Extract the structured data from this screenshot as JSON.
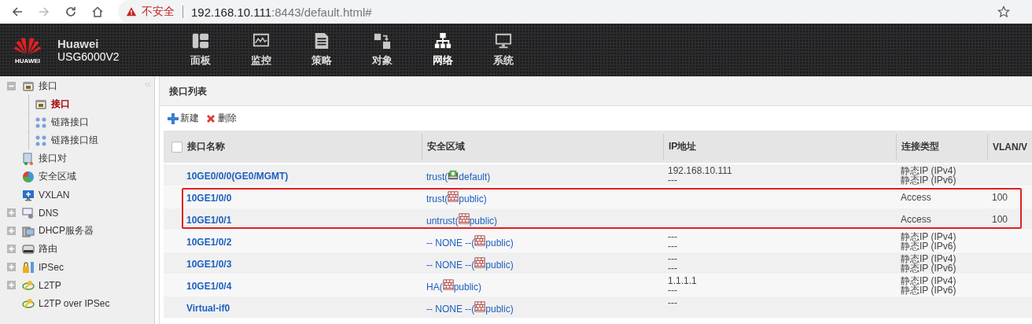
{
  "browser": {
    "forward_enabled": false,
    "security_label": "不安全",
    "url_host": "192.168.10.111",
    "url_rest": ":8443/default.html#"
  },
  "header": {
    "logo_text": "HUAWEI",
    "product": "Huawei",
    "model": "USG6000V2",
    "nav": [
      {
        "label": "面板",
        "kind": "dashboard",
        "selected": false
      },
      {
        "label": "监控",
        "kind": "monitor",
        "selected": false
      },
      {
        "label": "策略",
        "kind": "policy",
        "selected": false
      },
      {
        "label": "对象",
        "kind": "object",
        "selected": false
      },
      {
        "label": "网络",
        "kind": "network",
        "selected": true
      },
      {
        "label": "系统",
        "kind": "system",
        "selected": false
      }
    ]
  },
  "sidebar": {
    "items": [
      {
        "label": "接口",
        "kind": "port",
        "selected": false,
        "expanded": true,
        "children": [
          {
            "label": "接口",
            "kind": "port",
            "selected": true
          },
          {
            "label": "链路接口",
            "kind": "link",
            "selected": false
          },
          {
            "label": "链路接口组",
            "kind": "link",
            "selected": false
          }
        ]
      },
      {
        "label": "接口对",
        "kind": "pair",
        "selected": false
      },
      {
        "label": "安全区域",
        "kind": "zone",
        "selected": false
      },
      {
        "label": "VXLAN",
        "kind": "vxlan",
        "selected": false
      },
      {
        "label": "DNS",
        "kind": "dns",
        "selected": false,
        "expanded": false
      },
      {
        "label": "DHCP服务器",
        "kind": "dhcp",
        "selected": false,
        "expanded": false
      },
      {
        "label": "路由",
        "kind": "route",
        "selected": false,
        "expanded": false
      },
      {
        "label": "IPSec",
        "kind": "ipsec",
        "selected": false,
        "expanded": false
      },
      {
        "label": "L2TP",
        "kind": "key",
        "selected": false,
        "expanded": false
      },
      {
        "label": "L2TP over IPSec",
        "kind": "key",
        "selected": false
      }
    ]
  },
  "panel": {
    "title": "接口列表",
    "toolbar": [
      {
        "label": "新建",
        "kind": "add"
      },
      {
        "label": "删除",
        "kind": "delete"
      }
    ],
    "select_all_checked": false,
    "columns": [
      "接口名称",
      "安全区域",
      "IP地址",
      "连接类型",
      "VLAN/V"
    ],
    "rows": [
      {
        "name": "10GE0/0/0(GE0/MGMT)",
        "zone": {
          "prefix": "trust(",
          "kind": "vsys",
          "vsys": "default)"
        },
        "ip": [
          "192.168.10.111",
          "---"
        ],
        "type": [
          "静态IP (IPv4)",
          "静态IP (IPv6)"
        ],
        "highlighted": false
      },
      {
        "name": "10GE1/0/0",
        "zone": {
          "prefix": "trust(",
          "kind": "firewall",
          "vsys": "public)"
        },
        "type": [
          "Access"
        ],
        "vlan": "100",
        "highlighted": true
      },
      {
        "name": "10GE1/0/1",
        "zone": {
          "prefix": "untrust(",
          "kind": "firewall",
          "vsys": "public)"
        },
        "type": [
          "Access"
        ],
        "vlan": "100",
        "highlighted": true
      },
      {
        "name": "10GE1/0/2",
        "zone": {
          "prefix": "-- NONE --(",
          "kind": "firewall",
          "vsys": "public)"
        },
        "ip": [
          "---",
          "---"
        ],
        "type": [
          "静态IP (IPv4)",
          "静态IP (IPv6)"
        ],
        "highlighted": false
      },
      {
        "name": "10GE1/0/3",
        "zone": {
          "prefix": "-- NONE --(",
          "kind": "firewall",
          "vsys": "public)"
        },
        "ip": [
          "---",
          "---"
        ],
        "type": [
          "静态IP (IPv4)",
          "静态IP (IPv6)"
        ],
        "highlighted": false
      },
      {
        "name": "10GE1/0/4",
        "zone": {
          "prefix": "HA(",
          "kind": "firewall",
          "vsys": "public)"
        },
        "ip": [
          "1.1.1.1",
          "---"
        ],
        "type": [
          "静态IP (IPv4)",
          "静态IP (IPv6)"
        ],
        "highlighted": false
      },
      {
        "name": "Virtual-if0",
        "zone": {
          "prefix": "-- NONE --(",
          "kind": "firewall",
          "vsys": "public)"
        },
        "ip": [
          "---"
        ],
        "highlighted": false
      }
    ]
  }
}
